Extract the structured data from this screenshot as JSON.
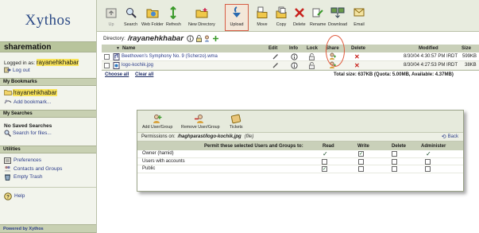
{
  "sidebar": {
    "logo": "Xythos",
    "user_band": "sharemation",
    "logged_in_prefix": "Logged in as:",
    "username": "rayanehkhabar",
    "logout": "Log out",
    "bookmarks_header": "My Bookmarks",
    "bookmark_item": "/rayanehkhabar",
    "add_bookmark": "Add bookmark...",
    "searches_header": "My Searches",
    "no_saved": "No Saved Searches",
    "search_files": "Search for files...",
    "utilities_header": "Utilities",
    "utilities": [
      "Preferences",
      "Contacts and Groups",
      "Empty Trash"
    ],
    "help": "Help",
    "powered": "Powered by Xythos"
  },
  "toolbar": {
    "buttons": [
      {
        "label": "Up",
        "icon": "up-folder-icon"
      },
      {
        "label": "Search",
        "icon": "search-icon"
      },
      {
        "label": "Web Folder",
        "icon": "web-folder-icon"
      },
      {
        "label": "Refresh",
        "icon": "refresh-icon"
      },
      {
        "label": "New Directory",
        "icon": "new-folder-icon"
      },
      {
        "label": "Upload",
        "icon": "upload-icon"
      },
      {
        "label": "Move",
        "icon": "move-icon"
      },
      {
        "label": "Copy",
        "icon": "copy-icon"
      },
      {
        "label": "Delete",
        "icon": "delete-icon"
      },
      {
        "label": "Rename",
        "icon": "rename-icon"
      },
      {
        "label": "Download",
        "icon": "download-icon"
      },
      {
        "label": "Email",
        "icon": "email-icon"
      }
    ]
  },
  "directory": {
    "label": "Directory:",
    "path": "/rayanehkhabar"
  },
  "grid": {
    "columns": {
      "name": "Name",
      "edit": "Edit",
      "info": "Info",
      "lock": "Lock",
      "share": "Share",
      "delete": "Delete",
      "modified": "Modified",
      "size": "Size"
    },
    "rows": [
      {
        "name": "Beethoven's Symphony No. 9 (Scherzo).wma",
        "modified": "8/30/04 4:30:57 PM IRDT",
        "size": "599KB"
      },
      {
        "name": "logo-kochik.jpg",
        "modified": "8/30/04 4:27:53 PM IRDT",
        "size": "38KB"
      }
    ],
    "choose_all": "Choose all",
    "clear_all": "Clear all",
    "total": "Total size: 637KB (Quota: 5.00MB, Available: 4.37MB)"
  },
  "dialog": {
    "buttons": [
      {
        "label": "Add User/Group",
        "icon": "add-user-icon"
      },
      {
        "label": "Remove User/Group",
        "icon": "remove-user-icon"
      },
      {
        "label": "Tickets",
        "icon": "tickets-icon"
      }
    ],
    "title_prefix": "Permissions on:",
    "file": "/haghparast/logo-kochik.jpg",
    "file_type": "(file)",
    "back": "Back",
    "header": "Permit these selected Users and Groups to:",
    "perm_columns": [
      "Read",
      "Write",
      "Delete",
      "Administer"
    ],
    "perm_rows": [
      {
        "name": "Owner (hamid)",
        "perms": [
          "tick",
          "checked",
          "empty",
          "tick"
        ]
      },
      {
        "name": "Users with accounts",
        "perms": [
          "empty",
          "empty",
          "empty",
          "empty"
        ]
      },
      {
        "name": "Public",
        "perms": [
          "checked",
          "empty",
          "empty",
          "empty"
        ]
      }
    ]
  },
  "colors": {
    "highlight": "#f8e35a",
    "band": "#c8d0b2",
    "accent_red": "#e05a3c",
    "link": "#2c3d8a"
  }
}
